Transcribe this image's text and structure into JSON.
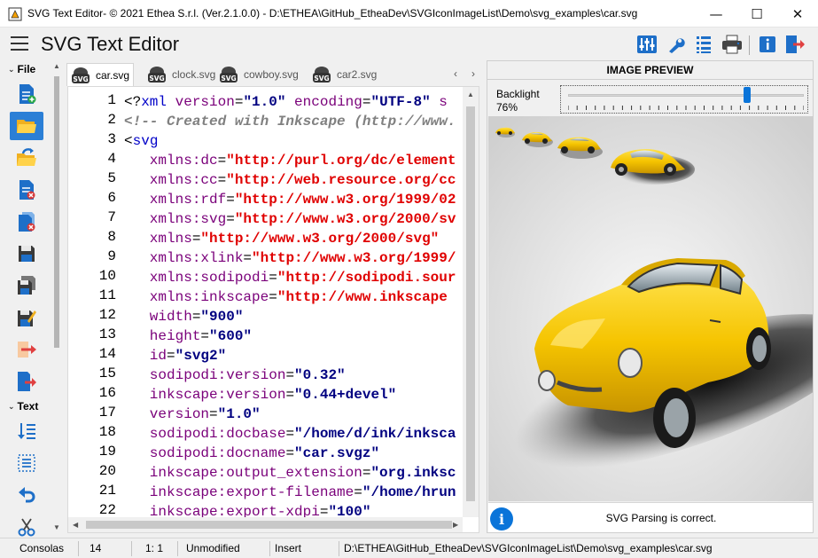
{
  "window": {
    "title": "SVG Text Editor- © 2021 Ethea S.r.l. (Ver.2.1.0.0) - D:\\ETHEA\\GitHub_EtheaDev\\SVGIconImageList\\Demo\\svg_examples\\car.svg",
    "minimize": "—",
    "maximize": "☐",
    "close": "✕"
  },
  "header": {
    "app_title": "SVG Text Editor",
    "toolbar_icons": [
      "settings-sliders-icon",
      "wrench-icon",
      "list-icon",
      "printer-icon",
      "info-icon",
      "exit-icon"
    ]
  },
  "sidebar": {
    "file_label": "File",
    "text_label": "Text",
    "file_actions": [
      "new-file-icon",
      "open-folder-icon",
      "reopen-icon",
      "close-file-icon",
      "close-all-icon",
      "save-icon",
      "save-as-icon",
      "save-all-icon",
      "export-icon",
      "exit-doc-icon"
    ],
    "text_actions": [
      "sort-icon",
      "select-all-icon",
      "undo-icon",
      "cut-icon"
    ]
  },
  "tabs": [
    {
      "label": "car.svg",
      "active": true
    },
    {
      "label": "clock.svg",
      "active": false
    },
    {
      "label": "cowboy.svg",
      "active": false
    },
    {
      "label": "car2.svg",
      "active": false
    }
  ],
  "tab_nav": {
    "prev": "‹",
    "next": "›"
  },
  "editor": {
    "line_numbers": [
      "1",
      "2",
      "3",
      "4",
      "5",
      "6",
      "7",
      "8",
      "9",
      "10",
      "11",
      "12",
      "13",
      "14",
      "15",
      "16",
      "17",
      "18",
      "19",
      "20",
      "21",
      "22"
    ],
    "lines": [
      [
        [
          "punct",
          "<?"
        ],
        [
          "tag",
          "xml"
        ],
        [
          "attr",
          " version"
        ],
        [
          "punct",
          "="
        ],
        [
          "num",
          "\"1.0\""
        ],
        [
          "attr",
          " encoding"
        ],
        [
          "punct",
          "="
        ],
        [
          "num",
          "\"UTF-8\""
        ],
        [
          "attr",
          " s"
        ]
      ],
      [
        [
          "com",
          "<!-- Created with Inkscape (http://www."
        ]
      ],
      [
        [
          "punct",
          "<"
        ],
        [
          "tag",
          "svg"
        ]
      ],
      [
        [
          "attr",
          "   xmlns:dc"
        ],
        [
          "punct",
          "="
        ],
        [
          "str",
          "\"http://purl.org/dc/element"
        ]
      ],
      [
        [
          "attr",
          "   xmlns:cc"
        ],
        [
          "punct",
          "="
        ],
        [
          "str",
          "\"http://web.resource.org/cc"
        ]
      ],
      [
        [
          "attr",
          "   xmlns:rdf"
        ],
        [
          "punct",
          "="
        ],
        [
          "str",
          "\"http://www.w3.org/1999/02"
        ]
      ],
      [
        [
          "attr",
          "   xmlns:svg"
        ],
        [
          "punct",
          "="
        ],
        [
          "str",
          "\"http://www.w3.org/2000/sv"
        ]
      ],
      [
        [
          "attr",
          "   xmlns"
        ],
        [
          "punct",
          "="
        ],
        [
          "str",
          "\"http://www.w3.org/2000/svg\""
        ]
      ],
      [
        [
          "attr",
          "   xmlns:xlink"
        ],
        [
          "punct",
          "="
        ],
        [
          "str",
          "\"http://www.w3.org/1999/"
        ]
      ],
      [
        [
          "attr",
          "   xmlns:sodipodi"
        ],
        [
          "punct",
          "="
        ],
        [
          "str",
          "\"http://sodipodi.sour"
        ]
      ],
      [
        [
          "attr",
          "   xmlns:inkscape"
        ],
        [
          "punct",
          "="
        ],
        [
          "str",
          "\"http://www.inkscape"
        ]
      ],
      [
        [
          "attr",
          "   width"
        ],
        [
          "punct",
          "="
        ],
        [
          "num",
          "\"900\""
        ]
      ],
      [
        [
          "attr",
          "   height"
        ],
        [
          "punct",
          "="
        ],
        [
          "num",
          "\"600\""
        ]
      ],
      [
        [
          "attr",
          "   id"
        ],
        [
          "punct",
          "="
        ],
        [
          "num",
          "\"svg2\""
        ]
      ],
      [
        [
          "attr",
          "   sodipodi:version"
        ],
        [
          "punct",
          "="
        ],
        [
          "num",
          "\"0.32\""
        ]
      ],
      [
        [
          "attr",
          "   inkscape:version"
        ],
        [
          "punct",
          "="
        ],
        [
          "num",
          "\"0.44+devel\""
        ]
      ],
      [
        [
          "attr",
          "   version"
        ],
        [
          "punct",
          "="
        ],
        [
          "num",
          "\"1.0\""
        ]
      ],
      [
        [
          "attr",
          "   sodipodi:docbase"
        ],
        [
          "punct",
          "="
        ],
        [
          "num",
          "\"/home/d/ink/inksca"
        ]
      ],
      [
        [
          "attr",
          "   sodipodi:docname"
        ],
        [
          "punct",
          "="
        ],
        [
          "num",
          "\"car.svgz\""
        ]
      ],
      [
        [
          "attr",
          "   inkscape:output_extension"
        ],
        [
          "punct",
          "="
        ],
        [
          "num",
          "\"org.inksc"
        ]
      ],
      [
        [
          "attr",
          "   inkscape:export-filename"
        ],
        [
          "punct",
          "="
        ],
        [
          "num",
          "\"/home/hrun"
        ]
      ],
      [
        [
          "attr",
          "   inkscape:export-xdpi"
        ],
        [
          "punct",
          "="
        ],
        [
          "num",
          "\"100\""
        ]
      ]
    ]
  },
  "preview": {
    "title": "IMAGE PREVIEW",
    "backlight_label": "Backlight",
    "backlight_value": "76%",
    "backlight_level": 0.76,
    "status_message": "SVG Parsing is correct.",
    "status_icon": "i"
  },
  "statusbar": {
    "font": "Consolas",
    "font_size": "14",
    "cursor": "1:  1",
    "modified": "Unmodified",
    "mode": "Insert",
    "path": "D:\\ETHEA\\GitHub_EtheaDev\\SVGIconImageList\\Demo\\svg_examples\\car.svg"
  },
  "colors": {
    "accent": "#2b7fd6",
    "car_yellow": "#f5c400",
    "code_string": "#e00000",
    "code_attr": "#7a007a"
  }
}
